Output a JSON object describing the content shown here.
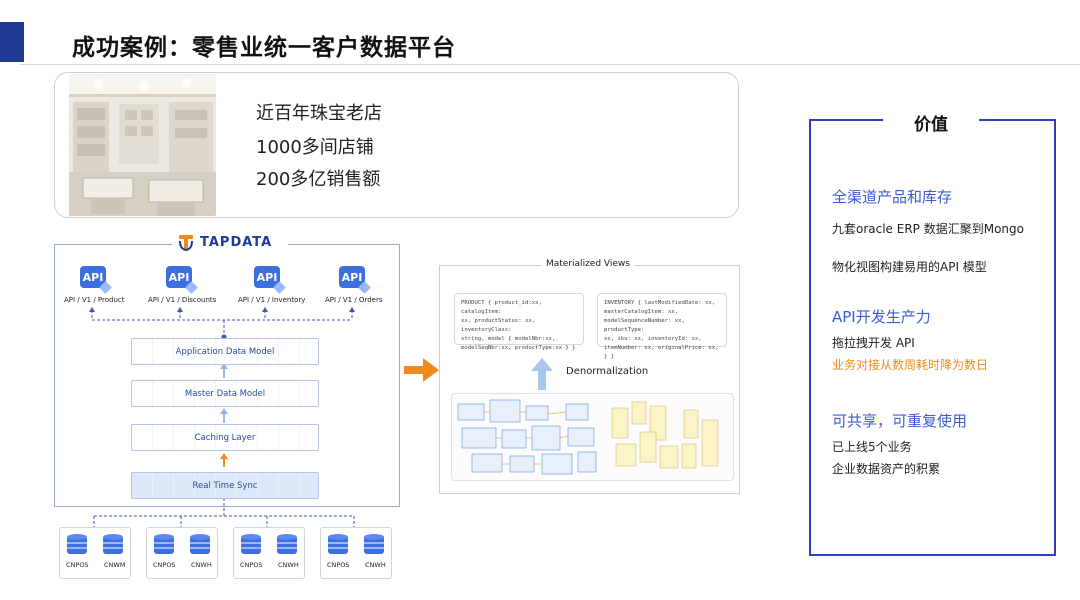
{
  "header": {
    "title": "成功案例：零售业统一客户数据平台"
  },
  "store": {
    "lines": [
      "近百年珠宝老店",
      "1000多间店铺",
      "200多亿销售额"
    ]
  },
  "architecture": {
    "logo": "TAPDATA",
    "apis": [
      {
        "icon": "API",
        "label": "API / V1 / Product"
      },
      {
        "icon": "API",
        "label": "API / V1 / Discounts"
      },
      {
        "icon": "API",
        "label": "API / V1 / Inventory"
      },
      {
        "icon": "API",
        "label": "API / V1 / Orders"
      }
    ],
    "layers": [
      "Application Data Model",
      "Master Data Model",
      "Caching Layer",
      "Real Time Sync"
    ],
    "sources": [
      {
        "a": "CNPOS",
        "b": "CNWM"
      },
      {
        "a": "CNPOS",
        "b": "CNWH"
      },
      {
        "a": "CNPOS",
        "b": "CNWH"
      },
      {
        "a": "CNPOS",
        "b": "CNWH"
      }
    ]
  },
  "materialized": {
    "title": "Materialized Views",
    "product_code": [
      "PRODUCT {    product_id:xx,    catalogItem:",
      "xx,   productStatus: xx,   inventoryClass:",
      "string,   model {      modelNbr:xx,",
      "modelSeqNbr:xx,      productType:xx  } }"
    ],
    "inventory_code": [
      "INVENTORY { lastModifiedDate: xx,",
      "masterCatalogItem: xx,",
      "modelSequenceNumber: xx,   productType:",
      "xx,   sku: xx,   inventoryId: xx,",
      "itemNumber: xx,    originalPrice: xx, } }"
    ],
    "denormalization": "Denormalization"
  },
  "value": {
    "title": "价值",
    "sections": [
      {
        "head": "全渠道产品和库存",
        "lines": [
          "九套oracle ERP 数据汇聚到Mongo",
          "物化视图构建易用的API 模型"
        ]
      },
      {
        "head": "API开发生产力",
        "lines": [
          "拖拉拽开发 API"
        ],
        "accent": "业务对接从数周耗时降为数日"
      },
      {
        "head": "可共享，可重复使用",
        "lines": [
          "已上线5个业务",
          "企业数据资产的积累"
        ]
      }
    ]
  },
  "colors": {
    "accent": "#3a5bd6",
    "orange": "#f08a1c",
    "brand": "#1f3a93"
  }
}
